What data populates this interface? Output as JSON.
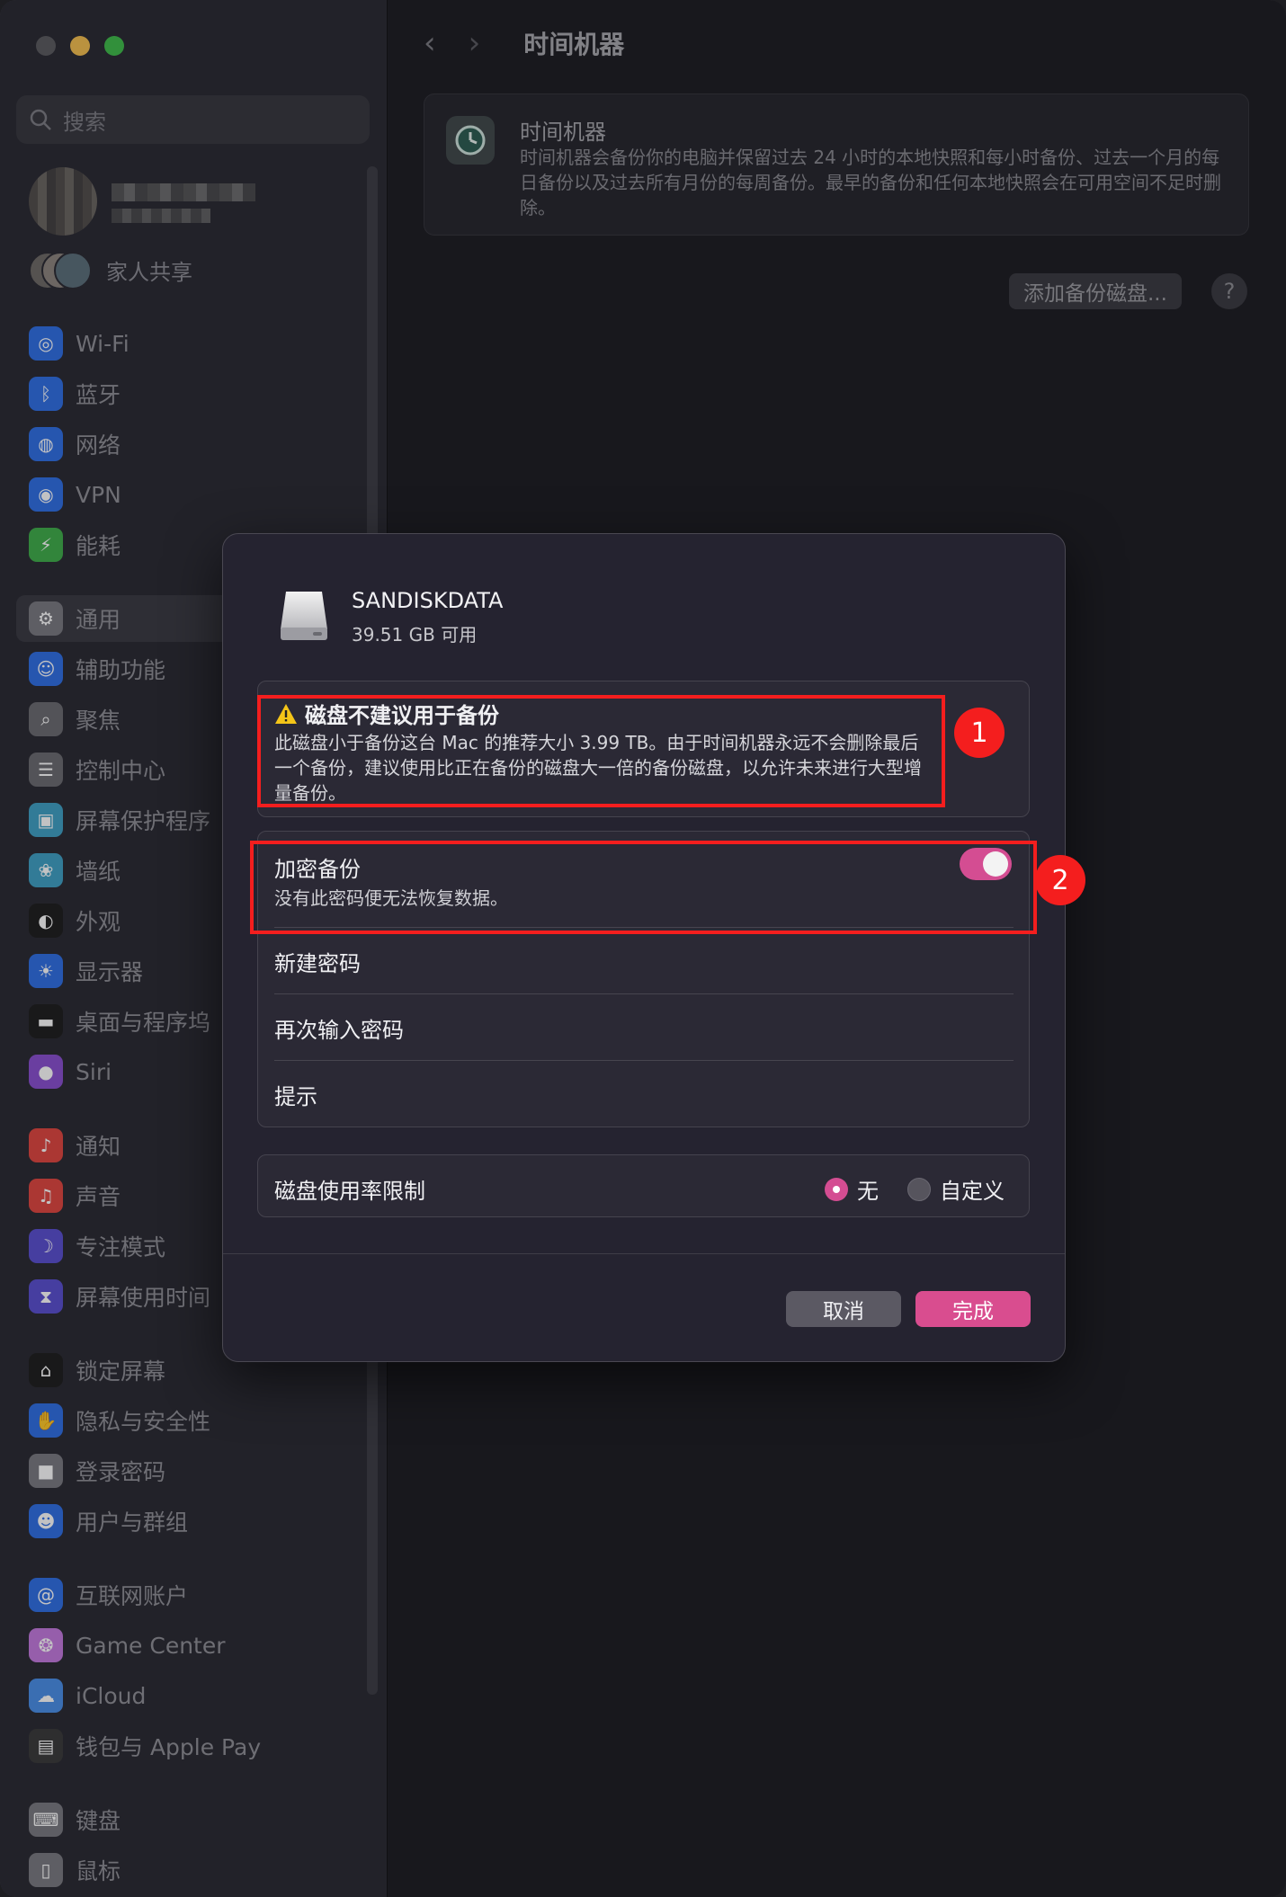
{
  "sidebar": {
    "search_placeholder": "搜索",
    "family_label": "家人共享",
    "items": [
      {
        "label": "Wi-Fi",
        "icon": "wifi-icon",
        "color": "#2f6fe4"
      },
      {
        "label": "蓝牙",
        "icon": "bluetooth-icon",
        "color": "#2f6fe4"
      },
      {
        "label": "网络",
        "icon": "globe-icon",
        "color": "#2f6fe4"
      },
      {
        "label": "VPN",
        "icon": "vpn-icon",
        "color": "#2f6fe4"
      },
      {
        "label": "能耗",
        "icon": "battery-icon",
        "color": "#3fae4a"
      },
      {
        "label": "通用",
        "icon": "gear-icon",
        "color": "#7a7a80"
      },
      {
        "label": "辅助功能",
        "icon": "accessibility-icon",
        "color": "#2f6fe4"
      },
      {
        "label": "聚焦",
        "icon": "magnifier-icon",
        "color": "#6b6b70"
      },
      {
        "label": "控制中心",
        "icon": "control-center-icon",
        "color": "#6b6b70"
      },
      {
        "label": "屏幕保护程序",
        "icon": "screensaver-icon",
        "color": "#3fa1c4"
      },
      {
        "label": "墙纸",
        "icon": "wallpaper-icon",
        "color": "#3fa1c4"
      },
      {
        "label": "外观",
        "icon": "appearance-icon",
        "color": "#1e1e1e"
      },
      {
        "label": "显示器",
        "icon": "display-icon",
        "color": "#2f6fe4"
      },
      {
        "label": "桌面与程序坞",
        "icon": "dock-icon",
        "color": "#1e1e1e"
      },
      {
        "label": "Siri",
        "icon": "siri-icon",
        "color": "#8a4fd0"
      },
      {
        "label": "通知",
        "icon": "bell-icon",
        "color": "#e0463f"
      },
      {
        "label": "声音",
        "icon": "speaker-icon",
        "color": "#e0463f"
      },
      {
        "label": "专注模式",
        "icon": "moon-icon",
        "color": "#5a4fd0"
      },
      {
        "label": "屏幕使用时间",
        "icon": "hourglass-icon",
        "color": "#5a4fd0"
      },
      {
        "label": "锁定屏幕",
        "icon": "lock-icon",
        "color": "#1e1e1e"
      },
      {
        "label": "隐私与安全性",
        "icon": "hand-icon",
        "color": "#2f6fe4"
      },
      {
        "label": "登录密码",
        "icon": "padlock-icon",
        "color": "#7a7a80"
      },
      {
        "label": "用户与群组",
        "icon": "users-icon",
        "color": "#2f6fe4"
      },
      {
        "label": "互联网账户",
        "icon": "at-icon",
        "color": "#2f6fe4"
      },
      {
        "label": "Game Center",
        "icon": "game-center-icon",
        "color": "#c47adf"
      },
      {
        "label": "iCloud",
        "icon": "cloud-icon",
        "color": "#4a8fe8"
      },
      {
        "label": "钱包与 Apple Pay",
        "icon": "wallet-icon",
        "color": "#3a3a3a"
      },
      {
        "label": "键盘",
        "icon": "keyboard-icon",
        "color": "#7a7a80"
      },
      {
        "label": "鼠标",
        "icon": "mouse-icon",
        "color": "#7a7a80"
      }
    ]
  },
  "main": {
    "title": "时间机器",
    "info_title": "时间机器",
    "info_desc": "时间机器会备份你的电脑并保留过去 24 小时的本地快照和每小时备份、过去一个月的每日备份以及过去所有月份的每周备份。最早的备份和任何本地快照会在可用空间不足时删除。",
    "add_disk_label": "添加备份磁盘...",
    "help_label": "?"
  },
  "dialog": {
    "disk_name": "SANDISKDATA",
    "disk_free": "39.51 GB 可用",
    "warning_title": "磁盘不建议用于备份",
    "warning_text": "此磁盘小于备份这台 Mac 的推荐大小 3.99 TB。由于时间机器永远不会删除最后一个备份，建议使用比正在备份的磁盘大一倍的备份磁盘，以允许未来进行大型增量备份。",
    "encrypt_title": "加密备份",
    "encrypt_subtitle": "没有此密码便无法恢复数据。",
    "encrypt_enabled": true,
    "new_password_label": "新建密码",
    "confirm_password_label": "再次输入密码",
    "hint_label": "提示",
    "usage_limit_label": "磁盘使用率限制",
    "usage_option_none": "无",
    "usage_option_custom": "自定义",
    "usage_selected": "无",
    "cancel_label": "取消",
    "done_label": "完成",
    "accent_color": "#d94d8f"
  },
  "annotations": [
    {
      "number": "1",
      "color": "#f41e1e"
    },
    {
      "number": "2",
      "color": "#f41e1e"
    }
  ]
}
